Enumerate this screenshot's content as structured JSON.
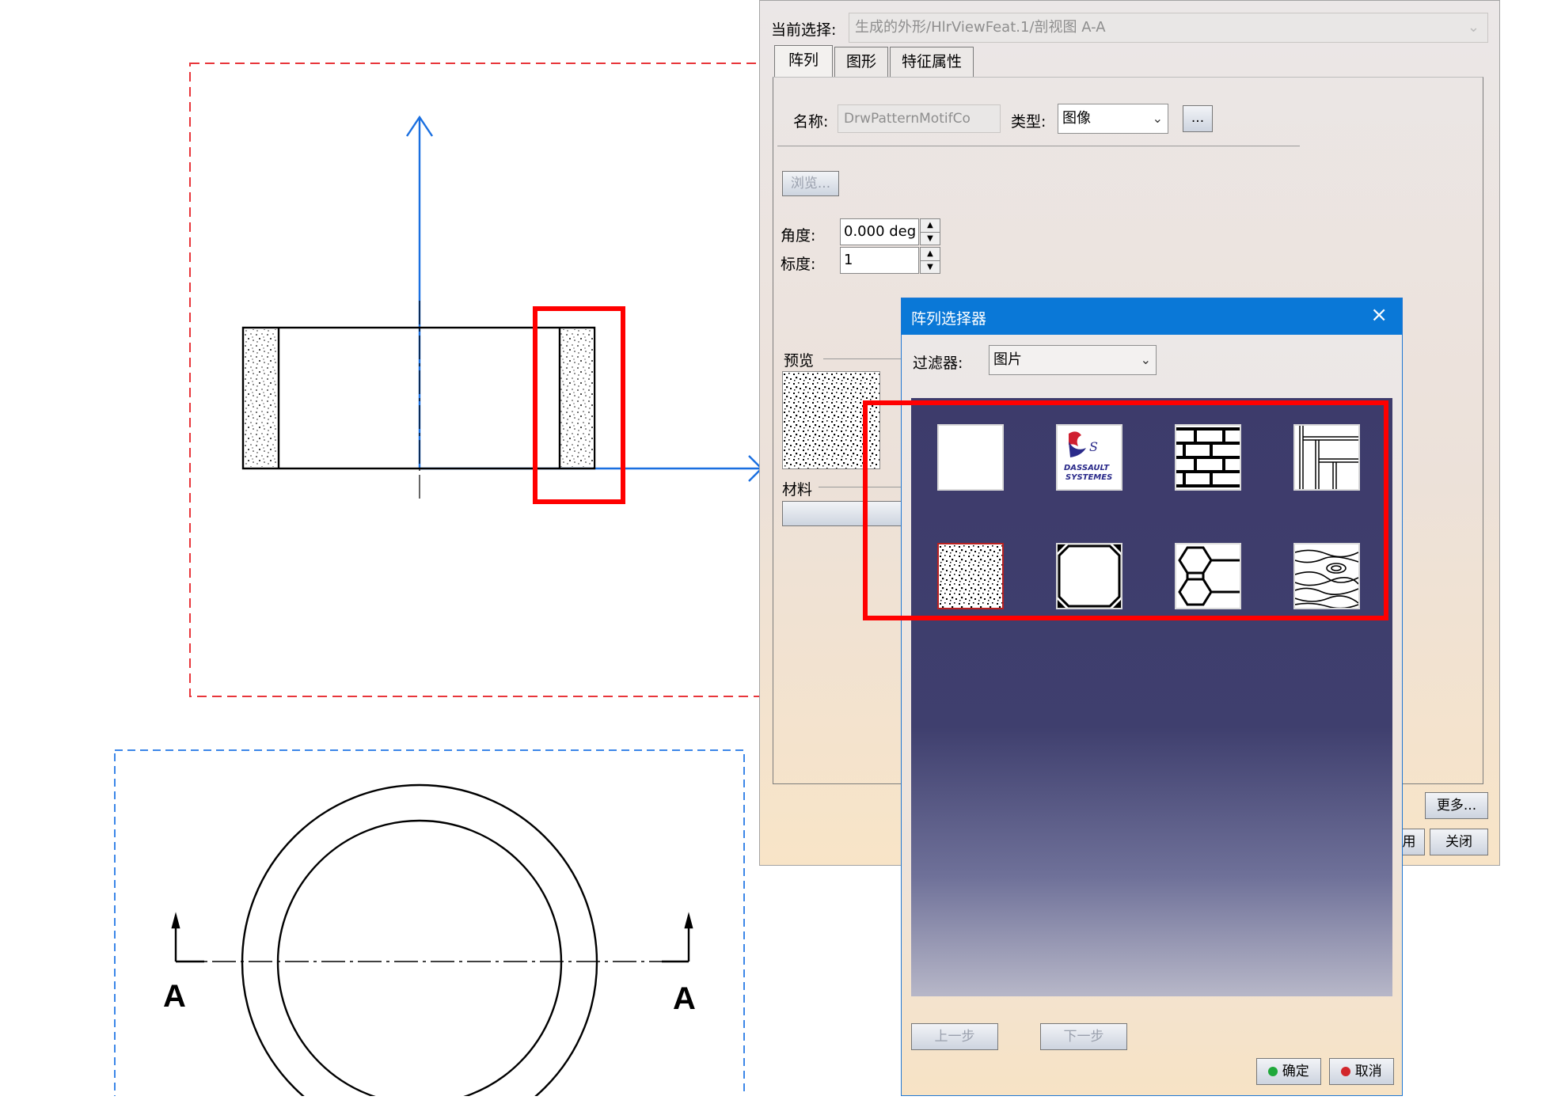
{
  "panel": {
    "current_selection_label": "当前选择:",
    "current_selection_value": "生成的外形/HlrViewFeat.1/剖视图 A-A",
    "tabs": [
      {
        "label": "阵列",
        "active": true
      },
      {
        "label": "图形",
        "active": false
      },
      {
        "label": "特征属性",
        "active": false
      }
    ],
    "name_label": "名称:",
    "name_value": "DrwPatternMotifCo",
    "type_label": "类型:",
    "type_value": "图像",
    "ellipsis_button": "...",
    "browse_button": "浏览...",
    "angle_label": "角度:",
    "angle_value": "0.000 deg",
    "scale_label": "标度:",
    "scale_value": "1",
    "preview_label": "预览",
    "material_label": "材料",
    "more_button": "更多...",
    "apply_button_partial": "用",
    "close_button": "关闭"
  },
  "dialog": {
    "title": "阵列选择器",
    "filter_label": "过滤器:",
    "filter_value": "图片",
    "patterns": [
      {
        "icon": "blank-pattern-icon",
        "selected": false
      },
      {
        "icon": "dassault-systemes-logo",
        "selected": false,
        "logo_text": [
          "DASSAULT",
          "SYSTEMES"
        ]
      },
      {
        "icon": "brick-pattern-icon",
        "selected": false
      },
      {
        "icon": "parquet-pattern-icon",
        "selected": false
      },
      {
        "icon": "speckle-pattern-icon",
        "selected": true
      },
      {
        "icon": "octagon-pattern-icon",
        "selected": false
      },
      {
        "icon": "hexagon-pattern-icon",
        "selected": false
      },
      {
        "icon": "wood-grain-pattern-icon",
        "selected": false
      }
    ],
    "prev_button": "上一步",
    "next_button": "下一步",
    "ok_button": "确定",
    "cancel_button": "取消"
  },
  "drawing": {
    "section_label_left": "A",
    "section_label_right": "A"
  },
  "colors": {
    "highlight": "#ff0000",
    "axis": "#1a6fe0",
    "view_frame_red": "#e8353a",
    "view_frame_blue": "#3b86e8",
    "title_bar": "#0a78d7"
  }
}
